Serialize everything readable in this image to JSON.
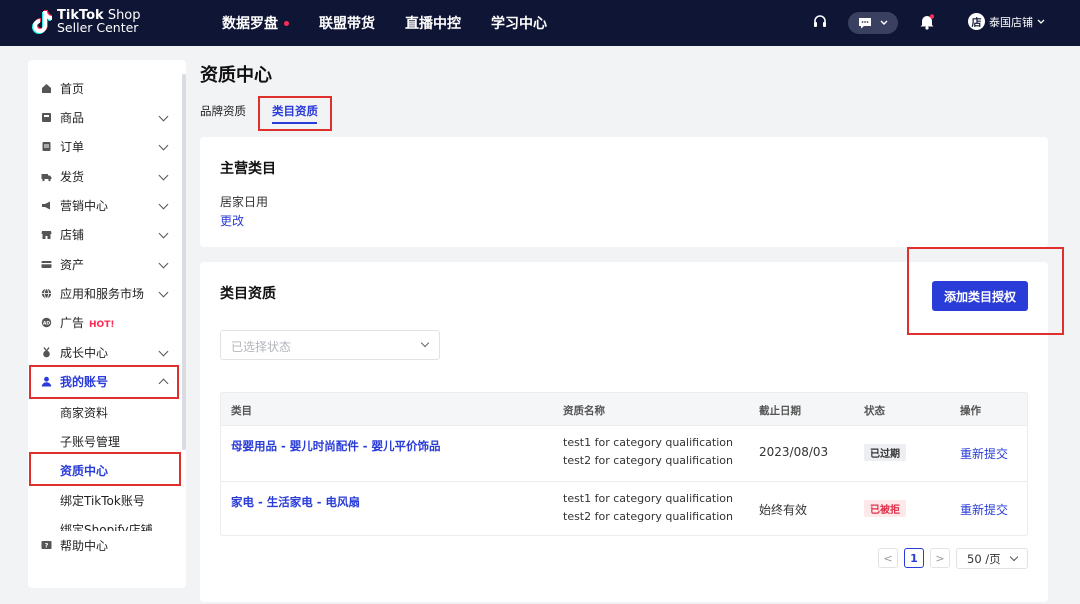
{
  "brand": {
    "line1_bold": "TikTok",
    "line1_rest": " Shop",
    "line2": "Seller Center"
  },
  "nav": [
    "数据罗盘",
    "联盟带货",
    "直播中控",
    "学习中心"
  ],
  "header_right": {
    "shop_label": "泰国店铺",
    "shop_badge": "店"
  },
  "sidebar": {
    "items": [
      {
        "label": "首页"
      },
      {
        "label": "商品"
      },
      {
        "label": "订单"
      },
      {
        "label": "发货"
      },
      {
        "label": "营销中心"
      },
      {
        "label": "店铺"
      },
      {
        "label": "资产"
      },
      {
        "label": "应用和服务市场"
      },
      {
        "label": "广告",
        "badge": "HOT!"
      },
      {
        "label": "成长中心"
      },
      {
        "label": "我的账号"
      }
    ],
    "sub_items": [
      "商家资料",
      "子账号管理",
      "资质中心",
      "绑定TikTok账号",
      "绑定Shopify店铺"
    ],
    "help": "帮助中心"
  },
  "page": {
    "title": "资质中心",
    "tabs": [
      "品牌资质",
      "类目资质"
    ]
  },
  "main_category": {
    "title": "主营类目",
    "value": "居家日用",
    "change": "更改"
  },
  "category_qual": {
    "title": "类目资质",
    "add_button": "添加类目授权",
    "status_placeholder": "已选择状态",
    "columns": [
      "类目",
      "资质名称",
      "截止日期",
      "状态",
      "操作"
    ],
    "rows": [
      {
        "category": "母婴用品 - 婴儿时尚配件 - 婴儿平价饰品",
        "qual1": "test1 for category qualification",
        "qual2": "test2 for category qualification",
        "deadline": "2023/08/03",
        "status": "已过期",
        "action": "重新提交"
      },
      {
        "category": "家电 - 生活家电 - 电风扇",
        "qual1": "test1 for category qualification",
        "qual2": "test2 for category qualification",
        "deadline": "始终有效",
        "status": "已被拒",
        "action": "重新提交"
      }
    ]
  },
  "pagination": {
    "prev": "<",
    "current": "1",
    "next": ">",
    "page_size": "50 /页"
  },
  "colors": {
    "accent": "#2a3cd8",
    "topbar": "#0f1535",
    "highlight_box": "#e0302e",
    "hot": "#fe2c55"
  }
}
